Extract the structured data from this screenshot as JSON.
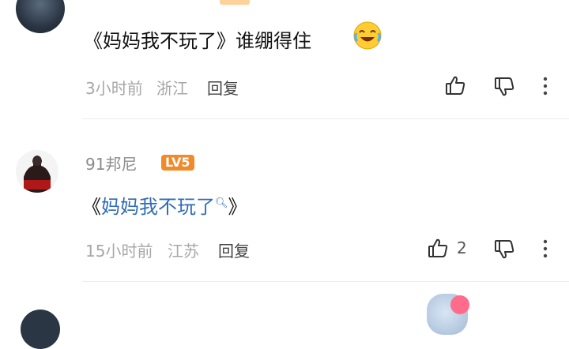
{
  "comments": [
    {
      "username": "",
      "text": "《妈妈我不玩了》谁绷得住",
      "emoji": "crying-laughing-emoji",
      "time": "3小时前",
      "location": "浙江",
      "reply_label": "回复",
      "likes": ""
    },
    {
      "username": "91邦尼",
      "level": "LV5",
      "text_open": "《",
      "text_link": "妈妈我不玩了",
      "text_close": "》",
      "time": "15小时前",
      "location": "江苏",
      "reply_label": "回复",
      "likes": "2"
    }
  ],
  "colors": {
    "link": "#2f6bb8",
    "level_badge": "#f08a2a",
    "meta": "#a7a7a7"
  }
}
